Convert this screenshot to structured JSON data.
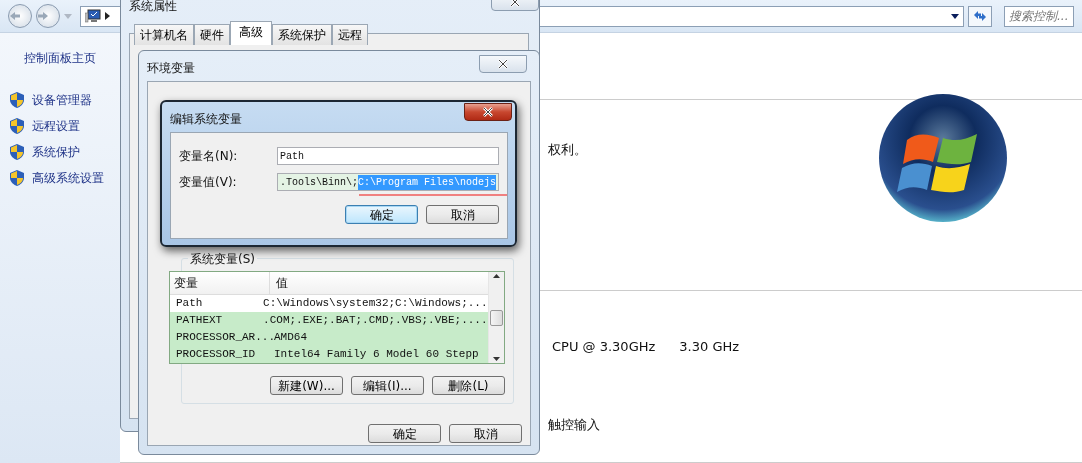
{
  "explorer": {
    "search_placeholder": "搜索控制...",
    "sidebar": {
      "home": "控制面板主页",
      "items": [
        "设备管理器",
        "远程设置",
        "系统保护",
        "高级系统设置"
      ]
    },
    "content": {
      "rights_text": "权利。",
      "cpu_text": "CPU @ 3.30GHz",
      "cpu_speed": "3.30 GHz",
      "touch_text": "触控输入"
    }
  },
  "system_properties": {
    "title": "系统属性",
    "tabs": [
      {
        "label": "计算机名",
        "selected": false
      },
      {
        "label": "硬件",
        "selected": false
      },
      {
        "label": "高级",
        "selected": true
      },
      {
        "label": "系统保护",
        "selected": false
      },
      {
        "label": "远程",
        "selected": false
      }
    ]
  },
  "environment_variables": {
    "title": "环境变量",
    "system_variables_label": "系统变量(S)",
    "columns": [
      "变量",
      "值"
    ],
    "rows": [
      {
        "name": "Path",
        "value": "C:\\Windows\\system32;C:\\Windows;...",
        "highlighted": false
      },
      {
        "name": "PATHEXT",
        "value": ".COM;.EXE;.BAT;.CMD;.VBS;.VBE;....",
        "highlighted": true
      },
      {
        "name": "PROCESSOR_AR...",
        "value": "AMD64",
        "highlighted": true
      },
      {
        "name": "PROCESSOR_ID",
        "value": "Intel64 Family 6 Model 60 Stepp",
        "highlighted": true
      }
    ],
    "buttons": [
      "新建(W)...",
      "编辑(I)...",
      "删除(L)"
    ],
    "footer_buttons": [
      "确定",
      "取消"
    ]
  },
  "edit_dialog": {
    "title": "编辑系统变量",
    "fields": [
      {
        "label": "变量名(N):",
        "value": "Path"
      },
      {
        "label": "变量值(V):",
        "value": ".Tools\\Binn\\;",
        "selected_text": "C:\\Program Files\\nodejs"
      }
    ],
    "buttons": [
      {
        "label": "确定",
        "default": true
      },
      {
        "label": "取消",
        "default": false
      }
    ]
  }
}
